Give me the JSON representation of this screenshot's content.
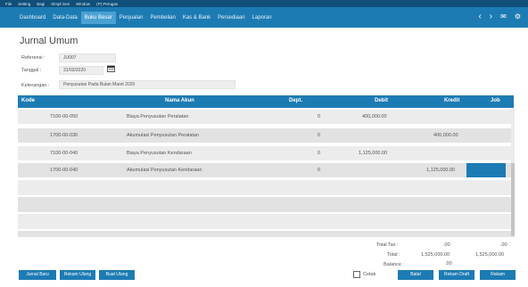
{
  "topbar": {
    "items": [
      "File",
      "Setting",
      "Bagi",
      "Simpl ines",
      "Window",
      "(P) Perugas"
    ]
  },
  "menubar": {
    "items": [
      "Dashboard",
      "Data-Data",
      "Buku Besar",
      "Penjualan",
      "Pembelian",
      "Kas & Bank",
      "Persediaan",
      "Laporan"
    ],
    "active_index": 2,
    "nav_prev": "‹",
    "nav_next": "›",
    "mail_icon": "✉",
    "settings_icon": "⚙"
  },
  "page_title": "Jurnal Umum",
  "form": {
    "referensi_label": "Referensi :",
    "referensi_value": "JU007",
    "tanggal_label": "Tanggal :",
    "tanggal_value": "31/03/2020",
    "keterangan_label": "Keterangan :",
    "keterangan_value": "Penyusutan Pada Bulan Maret 2020"
  },
  "table": {
    "headers": {
      "kode": "Kode",
      "nama_akun": "Nama Akun",
      "dept": "Dept.",
      "debit": "Debit",
      "kredit": "Kredit",
      "job": "Job"
    },
    "rows": [
      {
        "kode": "7100-00-050",
        "nama": "Biaya Penyusutan Peralatan",
        "dept": "0",
        "debit": "400,000.00",
        "kredit": ""
      },
      {
        "kode": "1700-00-030",
        "nama": "Akumulasi Penyusutan Peralatan",
        "dept": "0",
        "debit": "",
        "kredit": "400,000.00"
      },
      {
        "kode": "7100-00-040",
        "nama": "Biaya Penyusutan Kendaraan",
        "dept": "0",
        "debit": "1,125,000.00",
        "kredit": ""
      },
      {
        "kode": "1700-00-040",
        "nama": "Akumulasi Penyusutan Kendaraan",
        "dept": "0",
        "debit": "",
        "kredit": "1,125,000.00"
      }
    ],
    "empty_rows": 4
  },
  "totals": {
    "total_tax_label": "Total Tax :",
    "total_tax_debit": ".00",
    "total_tax_kredit": ".00",
    "total_label": "Total :",
    "total_debit": "1,525,000.00",
    "total_kredit": "1,525,000.00",
    "balance_label": "Balance :",
    "balance_value": ".00"
  },
  "buttons": {
    "jurnal_baru": "Jurnal Baru",
    "rekam_ulang": "Rekam Ulang",
    "buat_ulang": "Buat Ulang",
    "cetak": "Cetak",
    "batal": "Batal",
    "rekam_draft": "Rekam Draft",
    "rekam": "Rekam"
  },
  "colors": {
    "header_blue": "#1d7bb4",
    "topbar_blue": "#0f4f78",
    "active_tab": "#4aa1d3",
    "selected_cell": "#1d7bb4"
  }
}
